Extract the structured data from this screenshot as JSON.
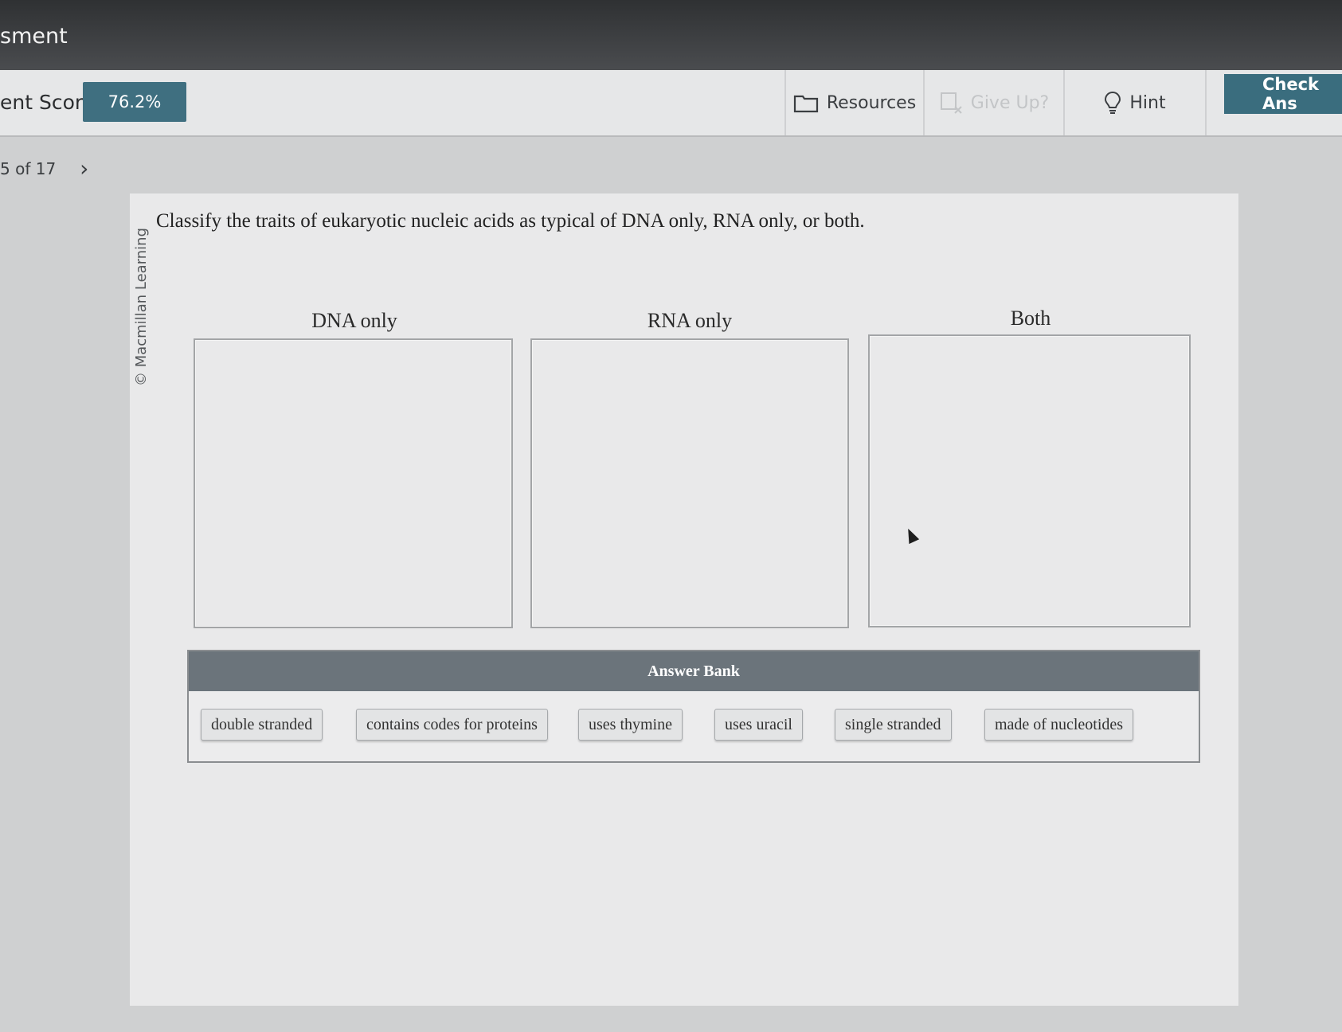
{
  "header": {
    "title": "sment"
  },
  "toolbar": {
    "score_label": "ent Score:",
    "score_value": "76.2%",
    "resources_label": "Resources",
    "give_up_label": "Give Up?",
    "hint_label": "Hint",
    "check_label": "Check Ans"
  },
  "pager": {
    "text": "5 of 17",
    "next_glyph": "›"
  },
  "question": {
    "copyright": "© Macmillan Learning",
    "prompt": "Classify the traits of eukaryotic nucleic acids as typical of DNA only, RNA only, or both."
  },
  "bins": [
    {
      "label": "DNA only"
    },
    {
      "label": "RNA only"
    },
    {
      "label": "Both"
    }
  ],
  "answer_bank": {
    "title": "Answer Bank",
    "items": [
      "double stranded",
      "contains codes for proteins",
      "uses thymine",
      "uses uracil",
      "single stranded",
      "made of nucleotides"
    ]
  },
  "colors": {
    "accent": "#3f6f80",
    "bank_header": "#6b747b"
  }
}
